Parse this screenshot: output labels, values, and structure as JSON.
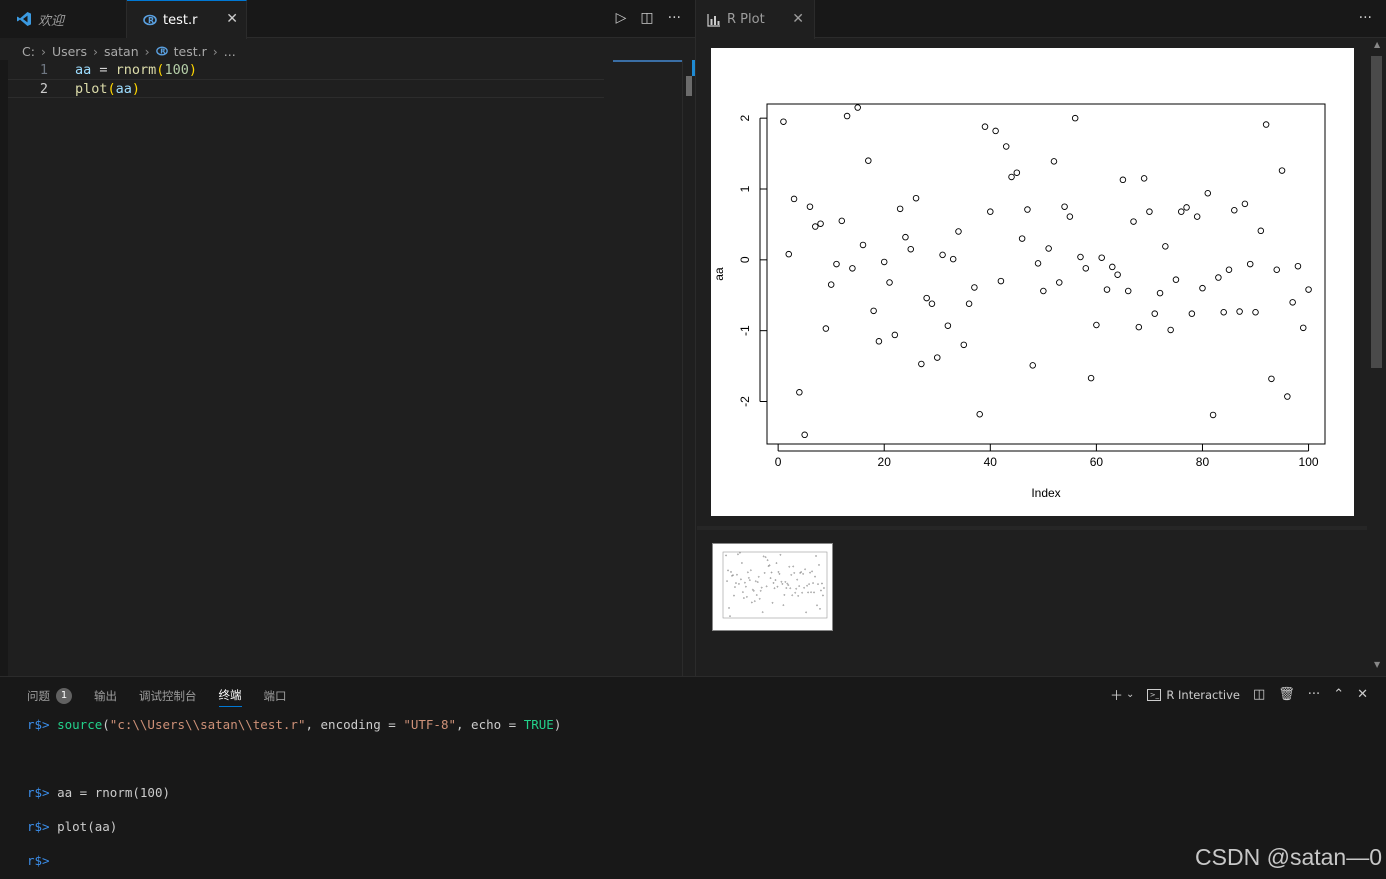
{
  "editor": {
    "tabs": [
      {
        "label": "欢迎",
        "icon": "vscode-logo-icon"
      },
      {
        "label": "test.r",
        "icon": "r-file-icon"
      }
    ],
    "breadcrumb": [
      "C:",
      "Users",
      "satan",
      "test.r",
      "..."
    ],
    "lines": [
      {
        "num": "1",
        "tokens": [
          [
            "aa",
            "var"
          ],
          [
            " = ",
            "op"
          ],
          [
            "rnorm",
            "fn"
          ],
          [
            "(",
            "paren"
          ],
          [
            "100",
            "num"
          ],
          [
            ")",
            "paren"
          ]
        ]
      },
      {
        "num": "2",
        "tokens": [
          [
            "plot",
            "fn"
          ],
          [
            "(",
            "paren"
          ],
          [
            "aa",
            "var"
          ],
          [
            ")",
            "paren"
          ]
        ]
      }
    ]
  },
  "plot_panel": {
    "tab_label": "R Plot",
    "tab_icon": "chart-icon"
  },
  "chart_data": {
    "type": "scatter",
    "title": "",
    "xlabel": "Index",
    "ylabel": "aa",
    "xlim": [
      1,
      100
    ],
    "ylim": [
      -2.6,
      2.2
    ],
    "xticks": [
      0,
      20,
      40,
      60,
      80,
      100
    ],
    "yticks": [
      -2,
      -1,
      0,
      1,
      2
    ],
    "marker": "open-circle",
    "x": [
      1,
      2,
      3,
      4,
      5,
      6,
      7,
      8,
      9,
      10,
      11,
      12,
      13,
      14,
      15,
      16,
      17,
      18,
      19,
      20,
      21,
      22,
      23,
      24,
      25,
      26,
      27,
      28,
      29,
      30,
      31,
      32,
      33,
      34,
      35,
      36,
      37,
      38,
      39,
      40,
      41,
      42,
      43,
      44,
      45,
      46,
      47,
      48,
      49,
      50,
      51,
      52,
      53,
      54,
      55,
      56,
      57,
      58,
      59,
      60,
      61,
      62,
      63,
      64,
      65,
      66,
      67,
      68,
      69,
      70,
      71,
      72,
      73,
      74,
      75,
      76,
      77,
      78,
      79,
      80,
      81,
      82,
      83,
      84,
      85,
      86,
      87,
      88,
      89,
      90,
      91,
      92,
      93,
      94,
      95,
      96,
      97,
      98,
      99,
      100
    ],
    "y": [
      1.95,
      0.08,
      0.86,
      -1.87,
      -2.47,
      0.75,
      0.47,
      0.51,
      -0.97,
      -0.35,
      -0.06,
      0.55,
      2.03,
      -0.12,
      2.15,
      0.21,
      1.4,
      -0.72,
      -1.15,
      -0.03,
      -0.32,
      -1.06,
      0.72,
      0.32,
      0.15,
      0.87,
      -1.47,
      -0.54,
      -0.62,
      -1.38,
      0.07,
      -0.93,
      0.01,
      0.4,
      -1.2,
      -0.62,
      -0.39,
      -2.18,
      1.88,
      0.68,
      1.82,
      -0.3,
      1.6,
      1.17,
      1.23,
      0.3,
      0.71,
      -1.49,
      -0.05,
      -0.44,
      0.16,
      1.39,
      -0.32,
      0.75,
      0.61,
      2.0,
      0.04,
      -0.12,
      -1.67,
      -0.92,
      0.03,
      -0.42,
      -0.1,
      -0.21,
      1.13,
      -0.44,
      0.54,
      -0.95,
      1.15,
      0.68,
      -0.76,
      -0.47,
      0.19,
      -0.99,
      -0.28,
      0.68,
      0.74,
      -0.76,
      0.61,
      -0.4,
      0.94,
      -2.19,
      -0.25,
      -0.74,
      -0.14,
      0.7,
      -0.73,
      0.79,
      -0.06,
      -0.74,
      0.41,
      1.91,
      -1.68,
      -0.14,
      1.26,
      -1.93,
      -0.6,
      -0.09,
      -0.96,
      -0.42
    ]
  },
  "panel": {
    "tabs": [
      {
        "label": "问题",
        "badge": "1",
        "active": false
      },
      {
        "label": "输出",
        "active": false
      },
      {
        "label": "调试控制台",
        "active": false
      },
      {
        "label": "终端",
        "active": true
      },
      {
        "label": "端口",
        "active": false
      }
    ],
    "terminal_name": "R Interactive",
    "terminal_lines": [
      {
        "prompt": "r$>",
        "tokens": [
          [
            "source",
            "src"
          ],
          [
            "(",
            "plain"
          ],
          [
            "\"c:\\\\Users\\\\satan\\\\test.r\"",
            "str"
          ],
          [
            ", encoding = ",
            "plain"
          ],
          [
            "\"UTF-8\"",
            "str"
          ],
          [
            ", echo = ",
            "plain"
          ],
          [
            "TRUE",
            "true"
          ],
          [
            ")",
            "plain"
          ]
        ]
      },
      {
        "prompt": "r$>",
        "tokens": [
          [
            "aa = rnorm(100)",
            "plain"
          ]
        ]
      },
      {
        "prompt": "r$>",
        "tokens": [
          [
            "plot(aa)",
            "plain"
          ]
        ]
      },
      {
        "prompt": "r$>",
        "tokens": []
      }
    ]
  },
  "watermark": "CSDN @satan—0"
}
